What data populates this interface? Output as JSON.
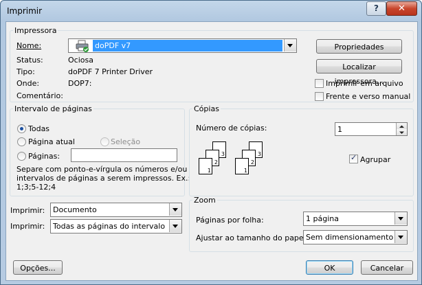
{
  "window": {
    "title": "Imprimir",
    "help_label": "?",
    "close_label": "✕"
  },
  "printer": {
    "legend": "Impressora",
    "name_label": "Nome:",
    "name_value": "doPDF v7",
    "status_label": "Status:",
    "status_value": "Ociosa",
    "type_label": "Tipo:",
    "type_value": "doPDF 7 Printer Driver",
    "where_label": "Onde:",
    "where_value": "DOP7:",
    "comment_label": "Comentário:",
    "properties_button": "Propriedades",
    "find_printer_button": "Localizar impressora...",
    "print_to_file_label": "Imprimir em arquivo",
    "duplex_label": "Frente e verso manual"
  },
  "range": {
    "legend": "Intervalo de páginas",
    "all_label": "Todas",
    "current_label": "Página atual",
    "selection_label": "Seleção",
    "pages_label": "Páginas:",
    "pages_value": "",
    "help_text_1": "Separe com ponto-e-vírgula os números e/ou",
    "help_text_2": "intervalos de páginas a serem impressos.  Ex.:",
    "help_text_3": "1;3;5-12;4"
  },
  "copies": {
    "legend": "Cópias",
    "count_label": "Número de cópias:",
    "count_value": "1",
    "collate_label": "Agrupar",
    "page_numbers": [
      "1",
      "2",
      "3"
    ]
  },
  "print_what": {
    "label_1": "Imprimir:",
    "value_1": "Documento",
    "label_2": "Imprimir:",
    "value_2": "Todas as páginas do intervalo"
  },
  "zoom": {
    "legend": "Zoom",
    "pages_per_sheet_label": "Páginas por folha:",
    "pages_per_sheet_value": "1 página",
    "scale_label": "Ajustar ao tamanho do papel:",
    "scale_value": "Sem dimensionamento"
  },
  "footer": {
    "options_button": "Opções...",
    "ok_button": "OK",
    "cancel_button": "Cancelar"
  }
}
